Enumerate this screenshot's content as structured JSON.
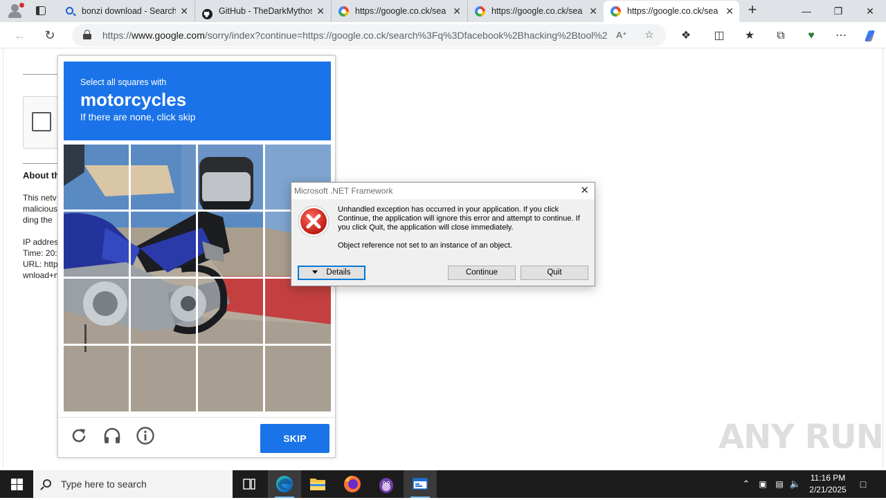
{
  "browser": {
    "tabs": [
      {
        "title": "bonzi download - Search",
        "favicon": "bing-search-icon"
      },
      {
        "title": "GitHub - TheDarkMythos",
        "favicon": "github-icon"
      },
      {
        "title": "https://google.co.ck/sea",
        "favicon": "google-icon"
      },
      {
        "title": "https://google.co.ck/sea",
        "favicon": "google-icon"
      },
      {
        "title": "https://google.co.ck/sea",
        "favicon": "google-icon",
        "active": true
      }
    ],
    "url_prefix": "https://",
    "url_host": "www.google.com",
    "url_rest": "/sorry/index?continue=https://google.co.ck/search%3Fq%3Dfacebook%2Bhacking%2Btool%2..."
  },
  "background_page": {
    "heading": "About th",
    "lines_1": [
      "This netv",
      "malicious",
      "ding the"
    ],
    "lines_2": [
      "IP addres",
      "Time: 20:",
      "URL: http",
      "wnload+n"
    ]
  },
  "captcha": {
    "instruction": "Select all squares with",
    "target": "motorcycles",
    "hint": "If there are none, click skip",
    "reload_icon": "reload-icon",
    "audio_icon": "headphones-icon",
    "info_icon": "info-icon",
    "skip_label": "SKIP",
    "accent": "#1a73e8"
  },
  "dialog": {
    "title": "Microsoft .NET Framework",
    "message": "Unhandled exception has occurred in your application. If you click Continue, the application will ignore this error and attempt to continue. If you click Quit, the application will close immediately.",
    "detail": "Object reference not set to an instance of an object.",
    "details_label": "Details",
    "continue_label": "Continue",
    "quit_label": "Quit",
    "icon": "error-icon"
  },
  "watermark": "ANY RUN",
  "taskbar": {
    "search_placeholder": "Type here to search",
    "time": "11:16 PM",
    "date": "2/21/2025",
    "apps": [
      "task-view-icon",
      "edge-icon",
      "file-explorer-icon",
      "firefox-icon",
      "bonzi-icon",
      "app-window-icon"
    ]
  }
}
